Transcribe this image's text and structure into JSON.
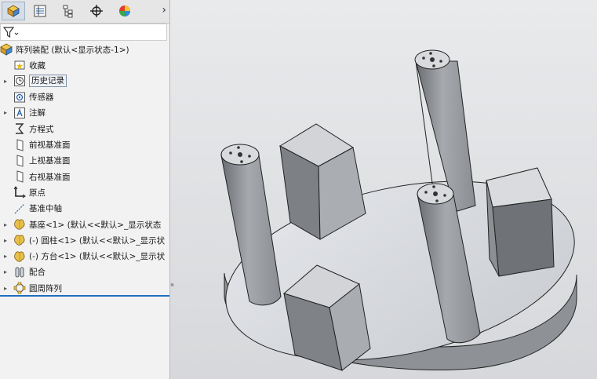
{
  "tabs": [
    {
      "name": "featuremanager-tab-icon",
      "active": true
    },
    {
      "name": "propertymanager-tab-icon",
      "active": false
    },
    {
      "name": "configurationmanager-tab-icon",
      "active": false
    },
    {
      "name": "dimxpert-tab-icon",
      "active": false
    },
    {
      "name": "display-manager-tab-icon",
      "active": false
    }
  ],
  "more_glyph": "›",
  "tree": {
    "root_label": "阵列装配  (默认<显示状态-1>)",
    "items": [
      {
        "label": "收藏",
        "icon": "favorites-icon",
        "expandable": false
      },
      {
        "label": "历史记录",
        "icon": "history-icon",
        "expandable": true,
        "boxed": true
      },
      {
        "label": "传感器",
        "icon": "sensor-icon",
        "expandable": false
      },
      {
        "label": "注解",
        "icon": "annotation-icon",
        "expandable": true
      },
      {
        "label": "方程式",
        "icon": "equation-icon",
        "expandable": false
      },
      {
        "label": "前视基准面",
        "icon": "plane-icon",
        "expandable": false
      },
      {
        "label": "上视基准面",
        "icon": "plane-icon",
        "expandable": false
      },
      {
        "label": "右视基准面",
        "icon": "plane-icon",
        "expandable": false
      },
      {
        "label": "原点",
        "icon": "origin-icon",
        "expandable": false
      },
      {
        "label": "基准中轴",
        "icon": "axis-icon",
        "expandable": false
      },
      {
        "label": "基座<1> (默认<<默认>_显示状态",
        "icon": "part-icon",
        "expandable": true
      },
      {
        "label": "(-) 圆柱<1> (默认<<默认>_显示状",
        "icon": "part-icon",
        "expandable": true
      },
      {
        "label": "(-) 方台<1> (默认<<默认>_显示状",
        "icon": "part-icon",
        "expandable": true
      },
      {
        "label": "配合",
        "icon": "mates-icon",
        "expandable": true
      },
      {
        "label": "圆周阵列",
        "icon": "circular-pattern-icon",
        "expandable": true
      }
    ]
  },
  "colors": {
    "panel_bg": "#f2f2f2",
    "selection_blue": "#1d6fc0",
    "part_yellow": "#e8c14a",
    "model_gray": "#9a9da2"
  }
}
